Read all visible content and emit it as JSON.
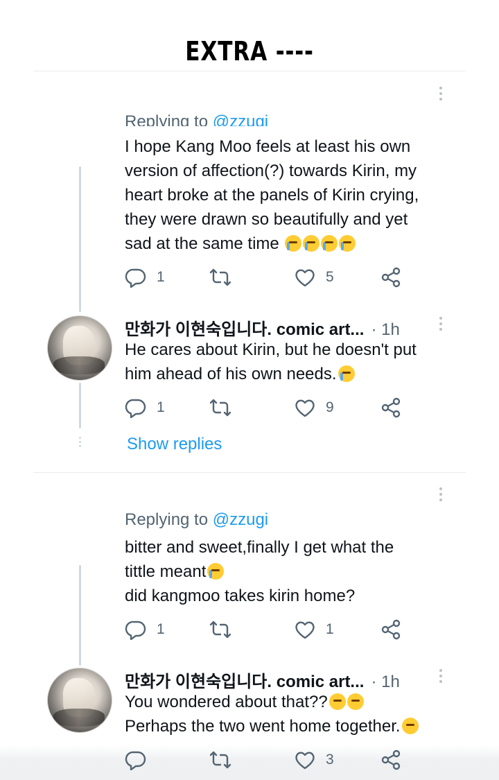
{
  "header": {
    "title": "EXTRA ----"
  },
  "thread1": {
    "replying_prefix": "Replying to ",
    "replying_handle": "@zzugi",
    "text_lines": [
      "I hope Kang Moo feels at least his own",
      "version of affection(?) towards Kirin, my",
      "heart broke at the panels of Kirin crying,",
      "they were drawn so beautifully and yet",
      "sad at the same time"
    ],
    "actions": {
      "replies": "1",
      "retweets": "",
      "likes": "5"
    },
    "reply": {
      "author": "만화가 이현숙입니다. comic art...",
      "time": "· 1h",
      "text_lines": [
        "He cares about Kirin, but he doesn't put",
        "him ahead of his own needs."
      ],
      "actions": {
        "replies": "1",
        "retweets": "",
        "likes": "9"
      }
    },
    "show_replies": "Show replies"
  },
  "thread2": {
    "replying_prefix": "Replying to ",
    "replying_handle": "@zzugi",
    "text_lines": [
      "bitter and sweet,finally I get what the",
      "tittle meant",
      "did kangmoo takes  kirin home?"
    ],
    "actions": {
      "replies": "1",
      "retweets": "",
      "likes": "1"
    },
    "reply": {
      "author": "만화가 이현숙입니다. comic art...",
      "time": "· 1h",
      "text_lines": [
        "You wondered about that??",
        "Perhaps the two went home together."
      ],
      "actions": {
        "replies": "",
        "retweets": "",
        "likes": "3"
      }
    }
  },
  "icons": {
    "reply": "reply-icon",
    "retweet": "retweet-icon",
    "like": "heart-icon",
    "share": "share-icon",
    "more": "more-icon"
  },
  "colors": {
    "link": "#1d9bf0",
    "muted": "#536471",
    "text": "#0f1419",
    "emoji": "#ffcc33"
  }
}
